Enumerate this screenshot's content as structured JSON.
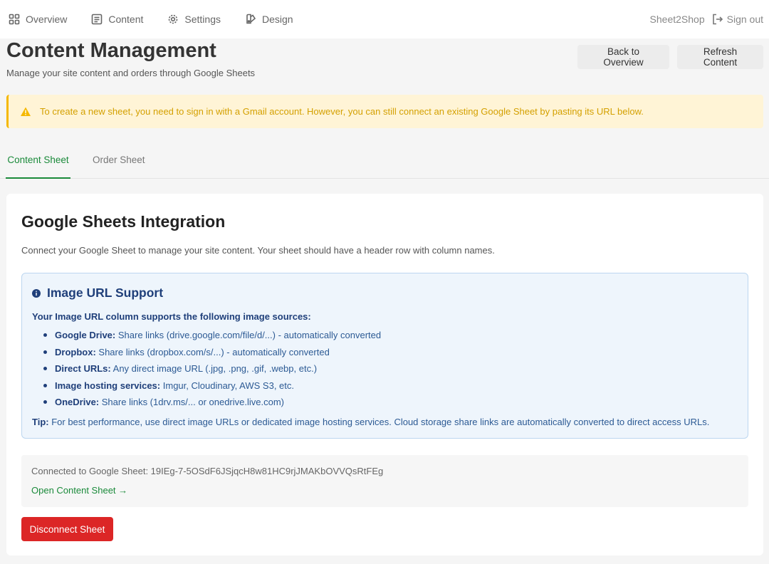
{
  "nav": {
    "items": [
      {
        "label": "Overview",
        "icon": "grid-icon"
      },
      {
        "label": "Content",
        "icon": "document-icon"
      },
      {
        "label": "Settings",
        "icon": "gear-icon"
      },
      {
        "label": "Design",
        "icon": "palette-icon"
      }
    ],
    "brand": "Sheet2Shop",
    "signout_label": "Sign out"
  },
  "header": {
    "title": "Content Management",
    "subtitle": "Manage your site content and orders through Google Sheets",
    "back_label": "Back to Overview",
    "refresh_label": "Refresh Content"
  },
  "alert": {
    "text": "To create a new sheet, you need to sign in with a Gmail account. However, you can still connect an existing Google Sheet by pasting its URL below."
  },
  "tabs": [
    {
      "label": "Content Sheet",
      "active": true
    },
    {
      "label": "Order Sheet",
      "active": false
    }
  ],
  "card": {
    "title": "Google Sheets Integration",
    "description": "Connect your Google Sheet to manage your site content. Your sheet should have a header row with column names."
  },
  "info": {
    "title": "Image URL Support",
    "intro": "Your Image URL column supports the following image sources:",
    "items": [
      {
        "name": "Google Drive:",
        "desc": "Share links (drive.google.com/file/d/...) - automatically converted"
      },
      {
        "name": "Dropbox:",
        "desc": "Share links (dropbox.com/s/...) - automatically converted"
      },
      {
        "name": "Direct URLs:",
        "desc": "Any direct image URL (.jpg, .png, .gif, .webp, etc.)"
      },
      {
        "name": "Image hosting services:",
        "desc": "Imgur, Cloudinary, AWS S3, etc."
      },
      {
        "name": "OneDrive:",
        "desc": "Share links (1drv.ms/... or onedrive.live.com)"
      }
    ],
    "tip_label": "Tip:",
    "tip_text": "For best performance, use direct image URLs or dedicated image hosting services. Cloud storage share links are automatically converted to direct access URLs."
  },
  "connection": {
    "text": "Connected to Google Sheet: 19IEg-7-5OSdF6JSjqcH8w81HC9rjJMAKbOVVQsRtFEg",
    "open_label": "Open Content Sheet →",
    "disconnect_label": "Disconnect Sheet"
  },
  "colors": {
    "accent_green": "#1a8a3a",
    "alert_bg": "#fff4d6",
    "alert_text": "#d4a000",
    "info_bg": "#eef5fc",
    "danger": "#dc2626"
  }
}
